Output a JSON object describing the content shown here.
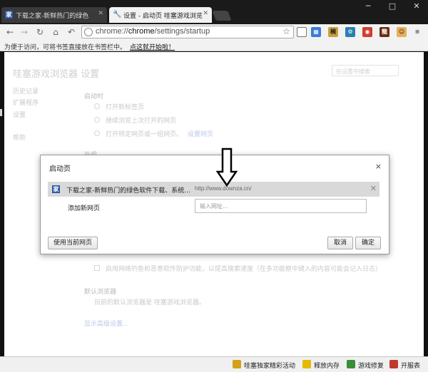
{
  "tabs": [
    {
      "label": "下载之家-新鲜热门的绿色",
      "icon": "downza-favicon",
      "close": "✕"
    },
    {
      "label": "设置 - 启动页 哇塞游戏浏览",
      "icon": "wrench-icon",
      "close": "✕"
    }
  ],
  "window": {
    "minimize": "─",
    "maximize": "□",
    "close": "✕"
  },
  "toolbar": {
    "url_prefix": "chrome://",
    "url_host": "chrome",
    "url_path": "/settings/startup",
    "icons": [
      "back-icon",
      "forward-icon",
      "reload-icon",
      "home-icon",
      "undo-icon",
      "star-icon"
    ]
  },
  "bookmarks_bar": {
    "text": "为便于访问，可将书签直接放在书签栏中。",
    "link": "点这就开始啦！"
  },
  "settings_bg": {
    "title": "哇塞游戏浏览器 设置",
    "search_placeholder": "在设置中搜索",
    "nav": [
      "历史记录",
      "扩展程序",
      "设置",
      "帮助"
    ],
    "startup_heading": "启动时",
    "startup_options": [
      "打开新标签页",
      "继续浏览上次打开的网页",
      "打开特定网页或一组网页。"
    ],
    "set_pages_link": "设置网页",
    "appearance_heading": "外观",
    "phishing_text": "启用网络钓鱼和恶意软件防护功能，以提高搜索速度（在多功能框中键入的内容可能会记入日志）",
    "default_browser_heading": "默认浏览器",
    "default_browser_text": "目前的默认浏览器是 哇塞游戏浏览器。",
    "advanced_link": "显示高级设置..."
  },
  "dialog": {
    "title": "启动页",
    "close": "×",
    "entry_icon": "家",
    "entry_title": "下载之家-新鲜热门的绿色软件下载、系统...",
    "entry_url": "http://www.downza.cn/",
    "entry_remove": "✕",
    "add_label": "添加新网页",
    "add_placeholder": "输入网址...",
    "use_current": "使用当前网页",
    "cancel": "取消",
    "ok": "确定"
  },
  "statusbar": [
    {
      "label": "哇塞独家精彩活动",
      "icon": "trophy-icon",
      "color": "#d4a017"
    },
    {
      "label": "释放内存",
      "icon": "broom-icon",
      "color": "#e6b800"
    },
    {
      "label": "游戏修复",
      "icon": "repair-icon",
      "color": "#3a8d3a"
    },
    {
      "label": "开服表",
      "icon": "server-list-icon",
      "color": "#c0392b"
    }
  ]
}
